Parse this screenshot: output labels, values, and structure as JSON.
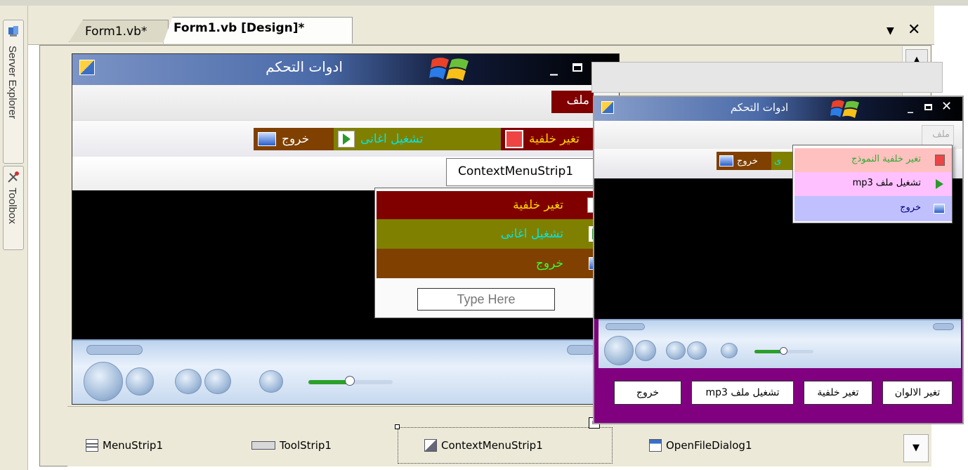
{
  "ide": {
    "tabs": [
      {
        "label": "Form1.vb*"
      },
      {
        "label": "Form1.vb [Design]*"
      }
    ],
    "side_panels": [
      "Server Explorer",
      "Toolbox"
    ],
    "tray": [
      "MenuStrip1",
      "ToolStrip1",
      "ContextMenuStrip1",
      "OpenFileDialog1"
    ]
  },
  "designer": {
    "title": "ادوات التحكم",
    "menu_item": "ملف",
    "toolstrip": [
      {
        "label": "تغير خلفية",
        "bg": "#800000",
        "color": "#ffd700"
      },
      {
        "label": "تشغيل اغانى",
        "bg": "#808000",
        "color": "#00e5e5"
      },
      {
        "label": "خروج",
        "bg": "#804000",
        "color": "#ffffff"
      }
    ],
    "context_tab": "ContextMenuStrip1",
    "context_items": [
      {
        "label": "تغير خلفية",
        "bg": "#800000",
        "color": "#ffd700"
      },
      {
        "label": "تشغيل اغانى",
        "bg": "#808000",
        "color": "#00e5e5"
      },
      {
        "label": "خروج",
        "bg": "#804000",
        "color": "#33ff33"
      }
    ],
    "type_here": "Type Here"
  },
  "runtime": {
    "title": "ادوات التحكم",
    "menu_item": "ملف",
    "toolstrip_partial": "ى",
    "toolstrip_exit": "خروج",
    "context_items": [
      {
        "label": "تغير خلفية النموذج",
        "bg": "#ffc0c0",
        "color": "#33aa33"
      },
      {
        "label": "تشغيل ملف mp3",
        "bg": "#ffc0ff",
        "color": "#000000"
      },
      {
        "label": "خروج",
        "bg": "#c0c0ff",
        "color": "#000080"
      }
    ],
    "buttons": [
      "تغير الالوان",
      "تغير خلفية",
      "تشغيل ملف mp3",
      "خروج"
    ]
  },
  "colors": {
    "titlebar": "#3a5a9a",
    "form_bottom": "#800080",
    "ide_bg": "#ece9d8"
  }
}
